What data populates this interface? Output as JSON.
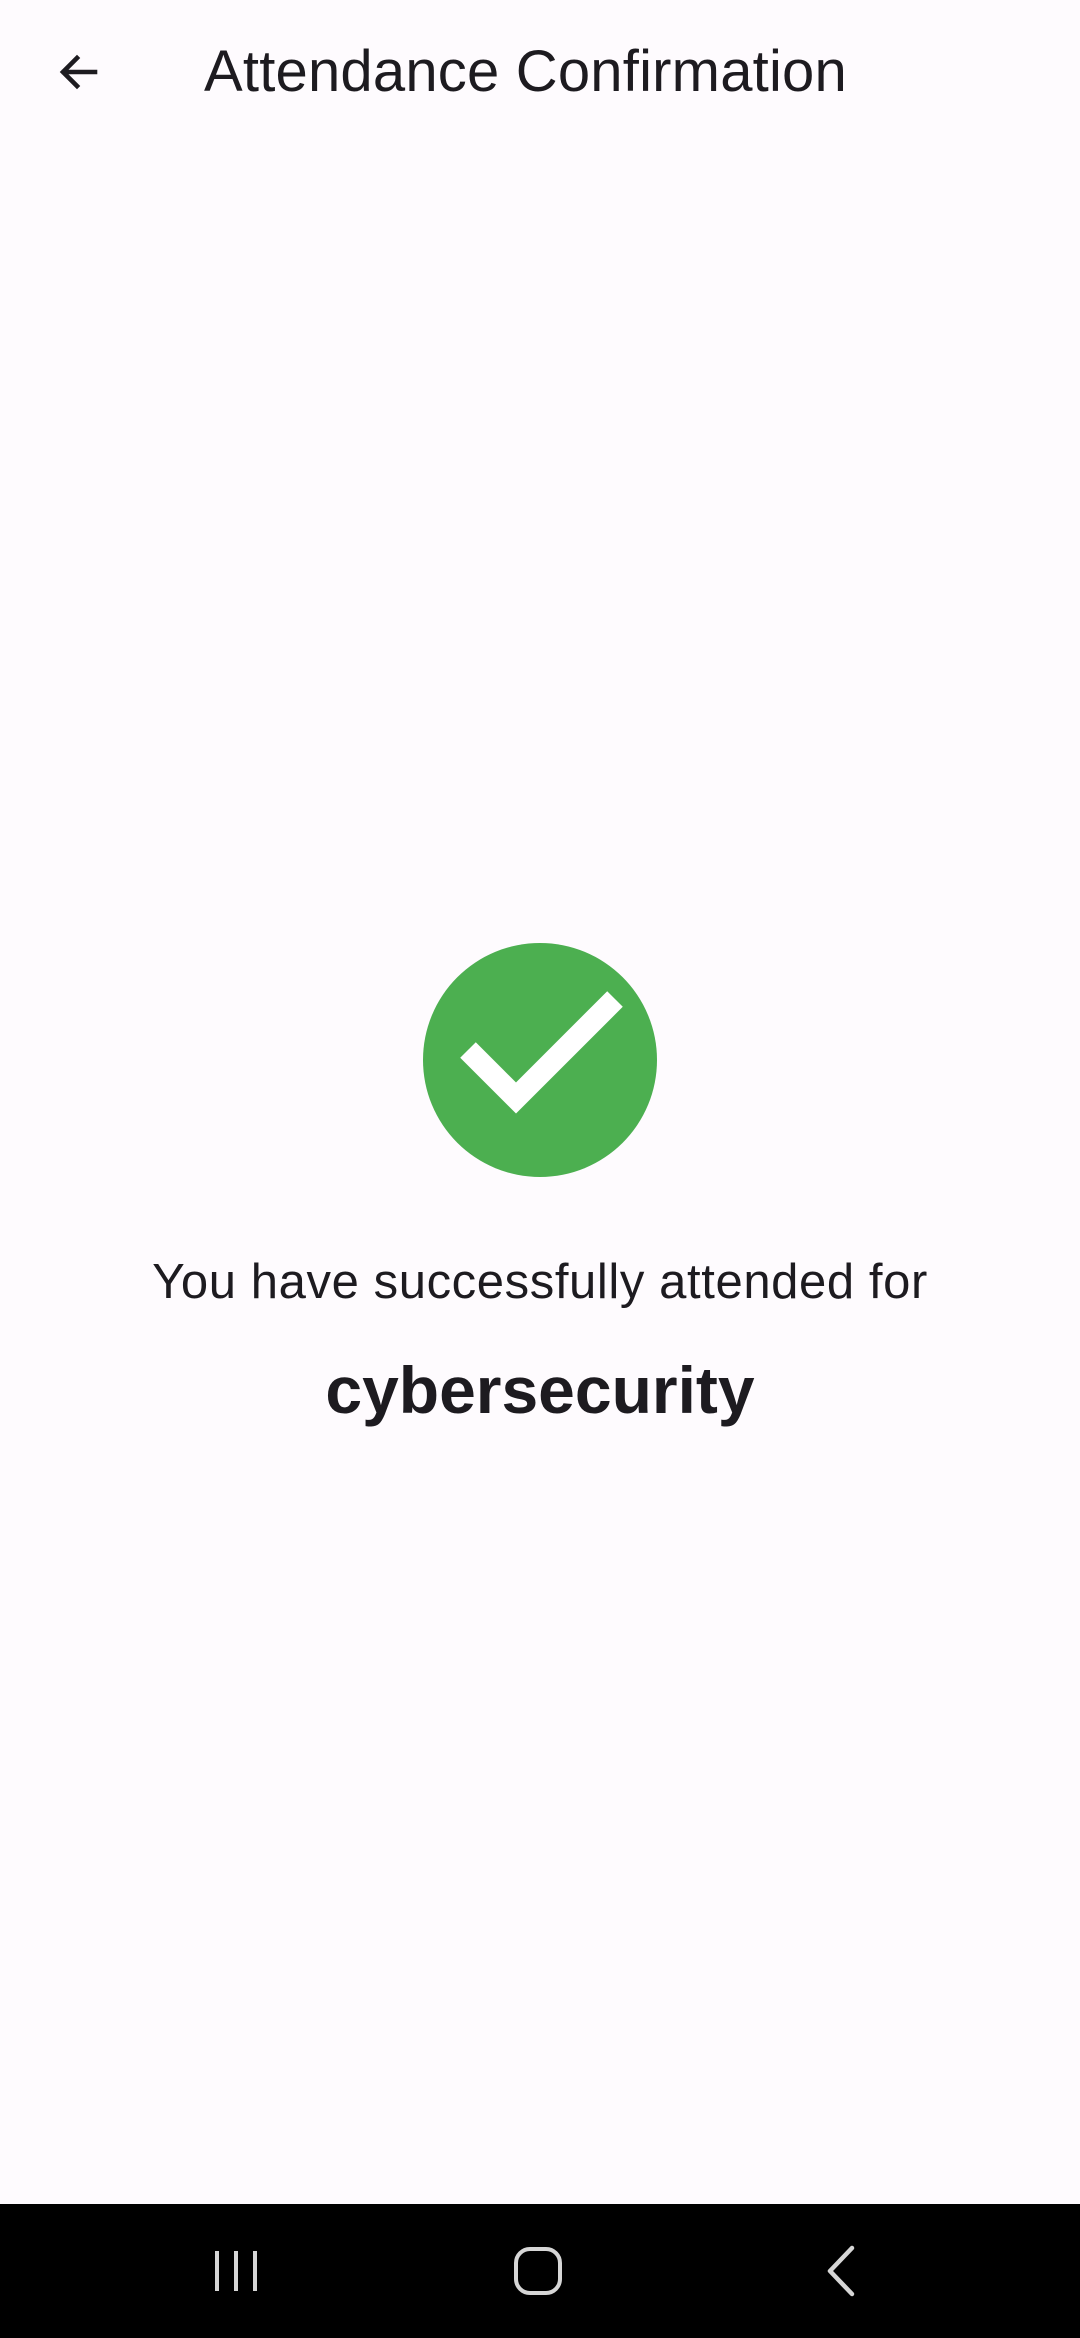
{
  "header": {
    "title": "Attendance Confirmation",
    "back_icon": "arrow-back-icon"
  },
  "main": {
    "status_icon": "check-circle-icon",
    "status_color": "#4caf50",
    "message": "You have successfully attended for",
    "course_name": "cybersecurity"
  },
  "system_nav": {
    "recents_icon": "recents-icon",
    "home_icon": "home-icon",
    "back_icon": "back-chevron-icon"
  }
}
